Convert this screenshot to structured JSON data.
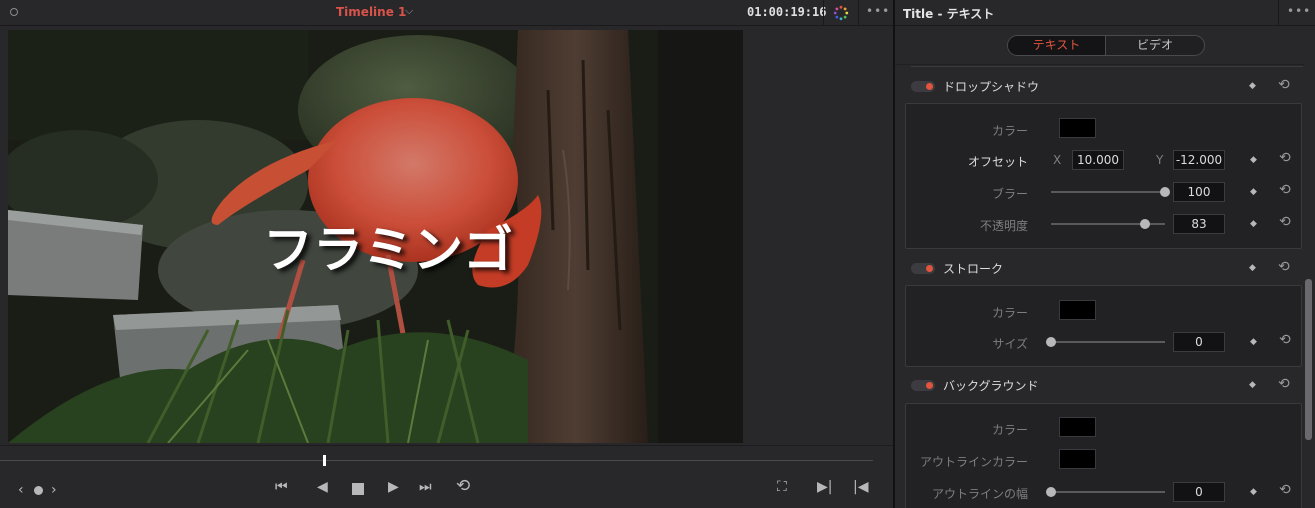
{
  "viewer": {
    "timeline_name": "Timeline 1",
    "timecode": "01:00:19:16",
    "title_text": "フラミンゴ"
  },
  "inspector": {
    "title": "Title - テキスト",
    "tabs": [
      {
        "label": "テキスト",
        "active": true
      },
      {
        "label": "ビデオ",
        "active": false
      }
    ],
    "drop_shadow": {
      "title": "ドロップシャドウ",
      "enabled": true,
      "color_label": "カラー",
      "color_value": "#000000",
      "offset_label": "オフセット",
      "offset_x_label": "X",
      "offset_x": "10.000",
      "offset_y_label": "Y",
      "offset_y": "-12.000",
      "blur_label": "ブラー",
      "blur": "100",
      "opacity_label": "不透明度",
      "opacity": "83"
    },
    "stroke": {
      "title": "ストローク",
      "enabled": true,
      "color_label": "カラー",
      "color_value": "#000000",
      "size_label": "サイズ",
      "size": "0"
    },
    "background": {
      "title": "バックグラウンド",
      "enabled": true,
      "color_label": "カラー",
      "color_value": "#000000",
      "outline_color_label": "アウトラインカラー",
      "outline_color_value": "#000000",
      "outline_width_label": "アウトラインの幅",
      "outline_width": "0"
    }
  },
  "colors": {
    "accent_red": "#e2543e",
    "panel_bg": "#28282b",
    "field_bg": "#121214"
  }
}
